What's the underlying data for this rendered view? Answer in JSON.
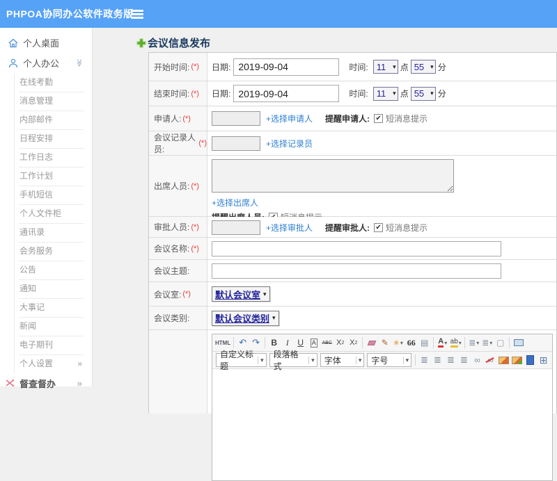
{
  "header": {
    "app_title": "PHPOA协同办公软件政务版"
  },
  "sidebar": {
    "desktop": {
      "label": "个人桌面"
    },
    "office": {
      "label": "个人办公",
      "chevron": "≫"
    },
    "office_submenu": [
      "在线考勤",
      "消息管理",
      "内部邮件",
      "日程安排",
      "工作日志",
      "工作计划",
      "手机短信",
      "个人文件柜",
      "通讯录",
      "会务服务",
      "公告",
      "通知",
      "大事记",
      "新闻",
      "电子期刊"
    ],
    "settings": {
      "label": "个人设置",
      "chevron": "»"
    },
    "supervision": {
      "label": "督查督办",
      "chevron": "»"
    }
  },
  "page": {
    "title": "会议信息发布"
  },
  "form": {
    "required_mark": "(*)",
    "labels": {
      "start_time": "开始时间:",
      "end_time": "结束时间:",
      "applicant": "申请人:",
      "recorder": "会议记录人员:",
      "attendees": "出席人员:",
      "approver": "审批人员:",
      "meeting_name": "会议名称:",
      "meeting_subject": "会议主题:",
      "meeting_room": "会议室:",
      "meeting_category": "会议类别:"
    },
    "date_label": "日期:",
    "time_label": "时间:",
    "hour_unit": "点",
    "minute_unit": "分",
    "start": {
      "date": "2019-09-04",
      "hour": "11",
      "minute": "55"
    },
    "end": {
      "date": "2019-09-04",
      "hour": "11",
      "minute": "55"
    },
    "links": {
      "choose_applicant": "+选择申请人",
      "choose_recorder": "+选择记录员",
      "choose_attendee": "+选择出席人",
      "choose_approver": "+选择审批人"
    },
    "remind": {
      "applicant": "提醒申请人:",
      "attendees": "提醒出席人员:",
      "approver": "提醒审批人:",
      "sms": "短消息提示"
    },
    "selects": {
      "room": "默认会议室",
      "category": "默认会议类别"
    }
  },
  "editor": {
    "html_button": "HTML",
    "glyphs": {
      "bold": "B",
      "italic": "I",
      "underline": "U",
      "font_box": "A",
      "strike": "ABC",
      "sup_base": "X",
      "sup_exp": "2",
      "sub_base": "X",
      "sub_idx": "2",
      "quote": "66",
      "font_color": "A",
      "highlight": "ab"
    },
    "dropdowns": {
      "style": "自定义标题",
      "paragraph": "段落格式",
      "font": "字体",
      "size": "字号"
    }
  },
  "icons": {
    "caret": "▾",
    "check": "✔",
    "undo": "↶",
    "redo": "↷",
    "brush": "✎",
    "wand": "✳",
    "paste": "▤",
    "olist": "≣",
    "ulist": "≣",
    "page": "▢",
    "align": "≣",
    "link": "∞",
    "table": "⊞"
  },
  "colors": {
    "header_bg": "#55a2f7",
    "link_blue": "#2f80d2",
    "accent_green": "#57ab2f",
    "required_red": "#f03b3b",
    "select_navy": "#23239b"
  }
}
